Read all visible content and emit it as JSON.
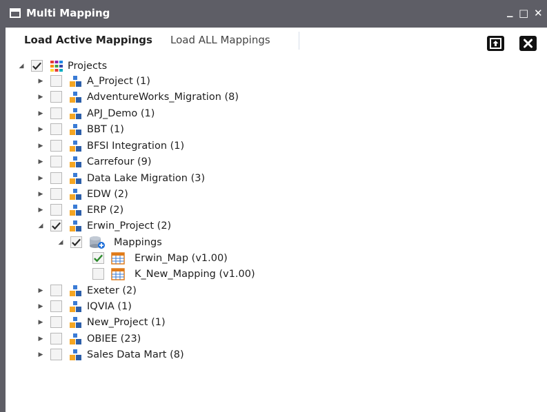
{
  "window": {
    "title": "Multi Mapping",
    "minimize_glyph": "_",
    "maximize_glyph": "□",
    "close_glyph": "✕",
    "header_color": "#5e5e66"
  },
  "toolbar": {
    "tab_active": "Load Active Mappings",
    "tab_all": "Load ALL Mappings",
    "export_icon": "upload-icon",
    "close_icon": "close-icon"
  },
  "tree": {
    "root": {
      "label": "Projects",
      "checked": true,
      "expanded": true
    },
    "projects": [
      {
        "label": "A_Project (1)"
      },
      {
        "label": "AdventureWorks_Migration (8)"
      },
      {
        "label": "APJ_Demo (1)"
      },
      {
        "label": "BBT (1)"
      },
      {
        "label": "BFSI Integration (1)"
      },
      {
        "label": "Carrefour (9)"
      },
      {
        "label": "Data Lake Migration (3)"
      },
      {
        "label": "EDW (2)"
      },
      {
        "label": "ERP (2)"
      },
      {
        "label": "Erwin_Project (2)",
        "checked": true,
        "expanded": true
      },
      {
        "label": "Exeter (2)"
      },
      {
        "label": "IQVIA (1)"
      },
      {
        "label": "New_Project (1)"
      },
      {
        "label": "OBIEE (23)"
      },
      {
        "label": "Sales Data Mart (8)"
      }
    ],
    "mappings_folder": {
      "label": "Mappings",
      "checked": true,
      "expanded": true
    },
    "mappings": [
      {
        "label": "Erwin_Map (v1.00)",
        "checked": true
      },
      {
        "label": "K_New_Mapping (v1.00)",
        "checked": false
      }
    ]
  },
  "colors": {
    "check_black": "#2b2b2b",
    "check_green": "#2e8b2e",
    "icon_orange": "#f5a623",
    "icon_blue": "#3a7bd5"
  }
}
